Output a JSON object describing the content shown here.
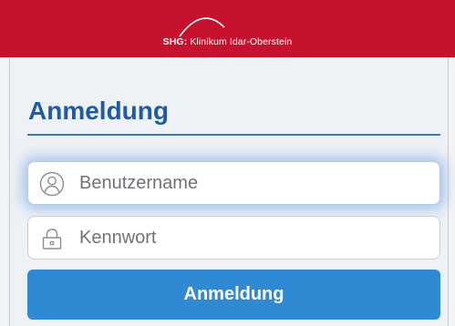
{
  "header": {
    "brand_short": "SHG:",
    "brand_name": "Klinikum Idar-Oberstein"
  },
  "login": {
    "title": "Anmeldung",
    "username_placeholder": "Benutzername",
    "password_placeholder": "Kennwort",
    "submit_label": "Anmeldung"
  },
  "colors": {
    "header_bg": "#c4122f",
    "title": "#1f5aa3",
    "button_bg": "#2f8ad3"
  },
  "icons": {
    "username": "user-icon",
    "password": "lock-icon"
  }
}
